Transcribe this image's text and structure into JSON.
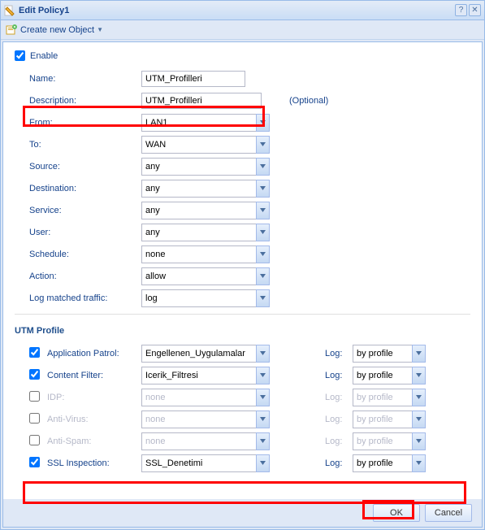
{
  "window": {
    "title": "Edit Policy1"
  },
  "toolbar": {
    "create_new_object": "Create new Object"
  },
  "form": {
    "enable_label": "Enable",
    "enable_checked": true,
    "name": {
      "label": "Name:",
      "value": "UTM_Profilleri"
    },
    "description": {
      "label": "Description:",
      "value": "UTM_Profilleri",
      "optional": "(Optional)"
    },
    "from": {
      "label": "From:",
      "value": "LAN1"
    },
    "to": {
      "label": "To:",
      "value": "WAN"
    },
    "source": {
      "label": "Source:",
      "value": "any"
    },
    "destination": {
      "label": "Destination:",
      "value": "any"
    },
    "service": {
      "label": "Service:",
      "value": "any"
    },
    "user": {
      "label": "User:",
      "value": "any"
    },
    "schedule": {
      "label": "Schedule:",
      "value": "none"
    },
    "action": {
      "label": "Action:",
      "value": "allow"
    },
    "log": {
      "label": "Log matched traffic:",
      "value": "log"
    }
  },
  "utm": {
    "section_title": "UTM Profile",
    "log_label": "Log:",
    "rows": [
      {
        "label": "Application Patrol:",
        "checked": true,
        "profile": "Engellenen_Uygulamalar",
        "log": "by profile",
        "enabled": true
      },
      {
        "label": "Content Filter:",
        "checked": true,
        "profile": "Icerik_Filtresi",
        "log": "by profile",
        "enabled": true
      },
      {
        "label": "IDP:",
        "checked": false,
        "profile": "none",
        "log": "by profile",
        "enabled": false
      },
      {
        "label": "Anti-Virus:",
        "checked": false,
        "profile": "none",
        "log": "by profile",
        "enabled": false
      },
      {
        "label": "Anti-Spam:",
        "checked": false,
        "profile": "none",
        "log": "by profile",
        "enabled": false
      },
      {
        "label": "SSL Inspection:",
        "checked": true,
        "profile": "SSL_Denetimi",
        "log": "by profile",
        "enabled": true
      }
    ]
  },
  "buttons": {
    "ok": "OK",
    "cancel": "Cancel"
  }
}
